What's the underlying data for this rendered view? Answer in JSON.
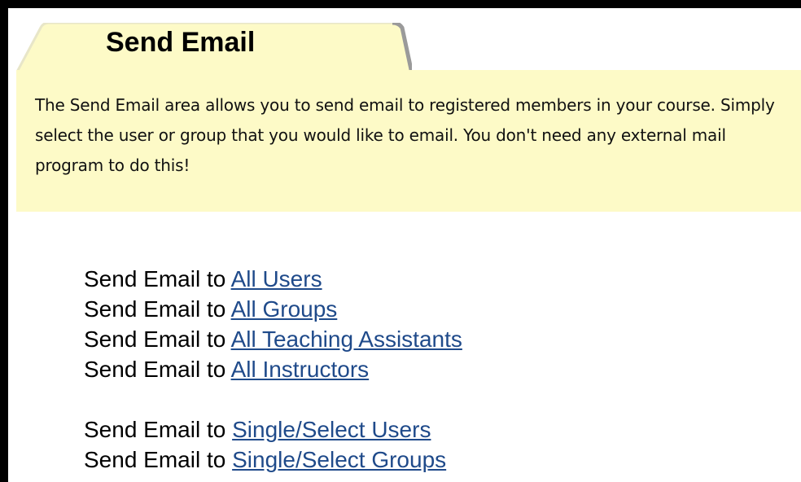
{
  "tab": {
    "title": "Send Email"
  },
  "description": "The Send Email area allows you to send email to registered members in your course. Simply select the user or group that you would like to email. You don't need any external mail program to do this!",
  "links_prefix": "Send Email to",
  "group1": [
    {
      "label": "All Users"
    },
    {
      "label": "All Groups"
    },
    {
      "label": "All Teaching Assistants"
    },
    {
      "label": "All Instructors"
    }
  ],
  "group2": [
    {
      "label": "Single/Select Users"
    },
    {
      "label": "Single/Select Groups"
    }
  ],
  "colors": {
    "panel": "#fdfac7",
    "link": "#1f4a8a",
    "border": "#000000"
  }
}
